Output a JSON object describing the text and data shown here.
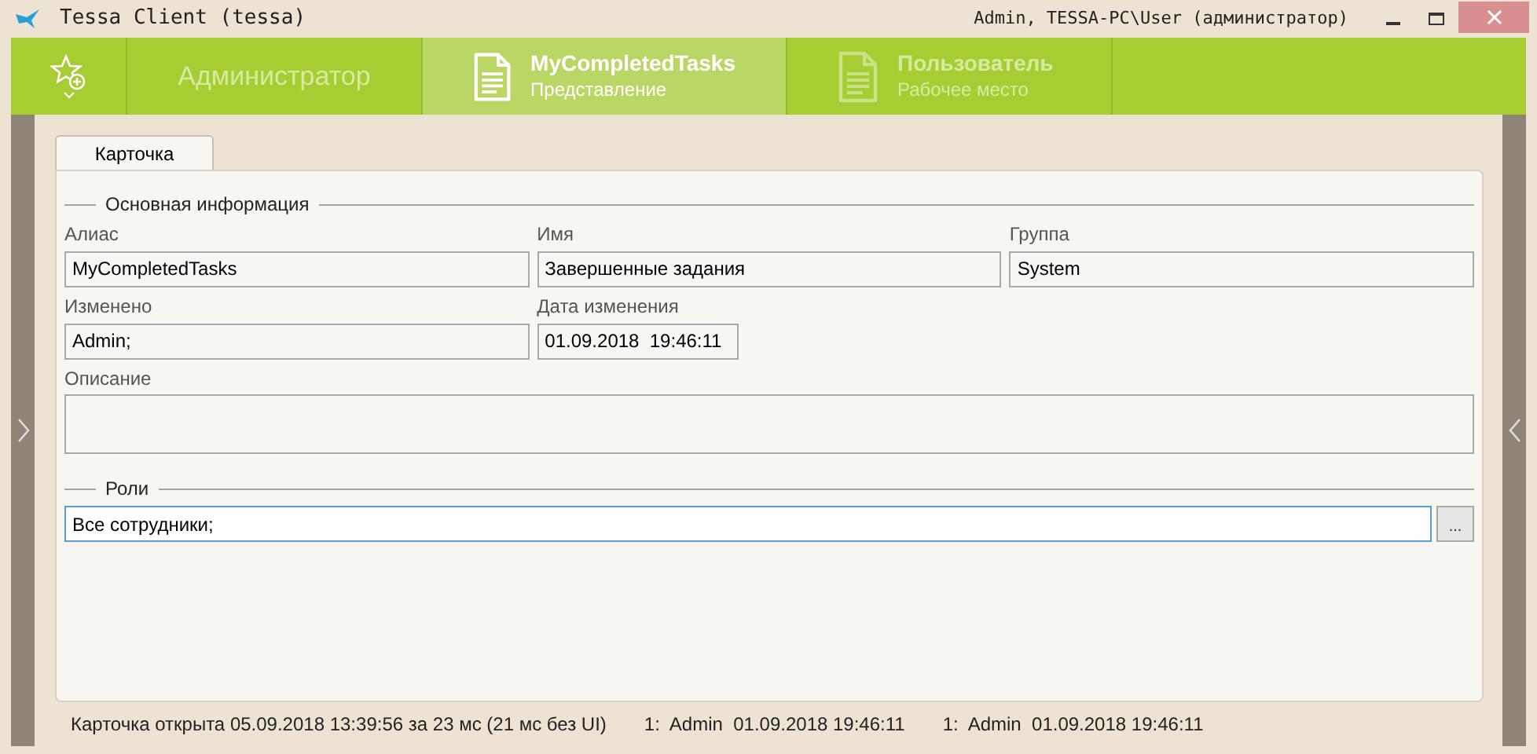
{
  "window": {
    "title": "Tessa Client (tessa)",
    "user": "Admin, TESSA-PC\\User (администратор)"
  },
  "nav_tabs": [
    {
      "kind": "plain",
      "title": "Администратор",
      "selected": false
    },
    {
      "kind": "document",
      "title": "MyCompletedTasks",
      "subtitle": "Представление",
      "selected": true
    },
    {
      "kind": "document",
      "title": "Пользователь",
      "subtitle": "Рабочее место",
      "selected": false
    }
  ],
  "card_tabs": [
    {
      "label": "Карточка",
      "selected": true
    }
  ],
  "sections": [
    {
      "title": "Основная информация",
      "rows": [
        [
          {
            "kind": "wide",
            "label": "Алиас",
            "value": "MyCompletedTasks"
          },
          {
            "kind": "wide",
            "label": "Имя",
            "value": "Завершенные задания"
          },
          {
            "kind": "wide",
            "label": "Группа",
            "value": "System"
          }
        ],
        [
          {
            "kind": "wide",
            "label": "Изменено",
            "value": "Admin;"
          },
          {
            "kind": "narrow",
            "label": "Дата изменения",
            "value": "01.09.2018  19:46:11"
          }
        ],
        [
          {
            "kind": "memo",
            "label": "Описание"
          }
        ]
      ]
    },
    {
      "title": "Роли",
      "rows": [
        [
          {
            "kind": "picker",
            "value": "Все сотрудники;",
            "focused": true,
            "button": "..."
          }
        ]
      ]
    }
  ],
  "status_bar": [
    "Карточка открыта 05.09.2018 13:39:56 за 23 мс (21 мс без UI)",
    "1:  Admin  01.09.2018 19:46:11",
    "1:  Admin  01.09.2018 19:46:11"
  ]
}
